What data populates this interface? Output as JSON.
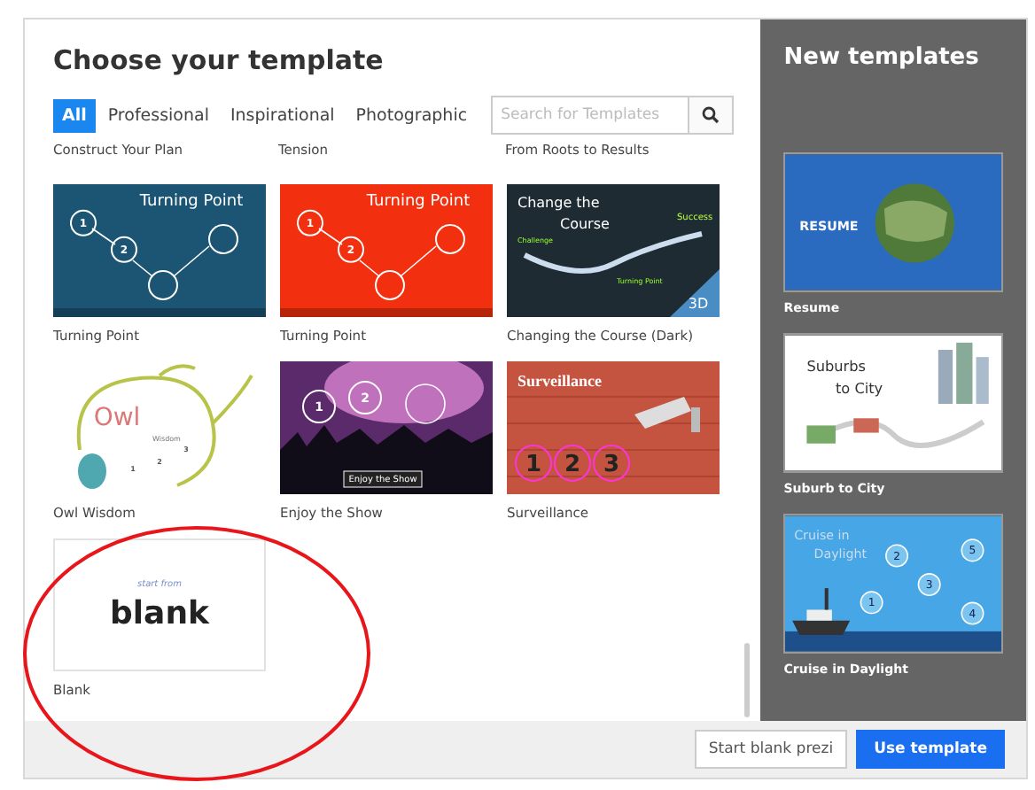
{
  "title": "Choose your template",
  "tabs": [
    {
      "label": "All",
      "selected": true
    },
    {
      "label": "Professional",
      "selected": false
    },
    {
      "label": "Inspirational",
      "selected": false
    },
    {
      "label": "Photographic",
      "selected": false
    }
  ],
  "search": {
    "placeholder": "Search for Templates"
  },
  "partial_row_labels": [
    "Construct Your Plan",
    "Tension",
    "From Roots to Results"
  ],
  "templates": [
    {
      "name": "Turning Point",
      "thumb": {
        "kind": "turning_point",
        "color": "#1b5573",
        "texts": [
          "Turning Point",
          "1",
          "2"
        ]
      }
    },
    {
      "name": "Turning Point",
      "thumb": {
        "kind": "turning_point",
        "color": "#f2300f",
        "texts": [
          "Turning Point",
          "1",
          "2"
        ]
      }
    },
    {
      "name": "Changing the Course (Dark)",
      "thumb": {
        "kind": "course",
        "texts": [
          "Change the",
          "Course",
          "Challenge",
          "Success",
          "Turning Point",
          "3D"
        ]
      }
    },
    {
      "name": "Owl Wisdom",
      "thumb": {
        "kind": "owl",
        "texts": [
          "Owl",
          "Wisdom",
          "1",
          "2",
          "3"
        ]
      }
    },
    {
      "name": "Enjoy the Show",
      "thumb": {
        "kind": "concert",
        "texts": [
          "1",
          "2",
          "Enjoy the Show"
        ]
      }
    },
    {
      "name": "Surveillance",
      "thumb": {
        "kind": "surveillance",
        "texts": [
          "Surveillance",
          "1",
          "2",
          "3"
        ]
      }
    },
    {
      "name": "Blank",
      "thumb": {
        "kind": "blank",
        "texts": [
          "start from",
          "blank"
        ]
      }
    }
  ],
  "new_templates": {
    "title": "New templates",
    "items": [
      {
        "name": "Resume",
        "thumb": {
          "kind": "resume",
          "texts": [
            "RESUME"
          ]
        }
      },
      {
        "name": "Suburb to City",
        "thumb": {
          "kind": "suburbs",
          "texts": [
            "Suburbs",
            "to City"
          ]
        }
      },
      {
        "name": "Cruise in Daylight",
        "thumb": {
          "kind": "cruise",
          "texts": [
            "Cruise in",
            "Daylight",
            "1",
            "2",
            "3",
            "4",
            "5"
          ]
        }
      }
    ]
  },
  "buttons": [
    {
      "label": "Start blank prezi",
      "primary": false
    },
    {
      "label": "Use template",
      "primary": true
    }
  ]
}
